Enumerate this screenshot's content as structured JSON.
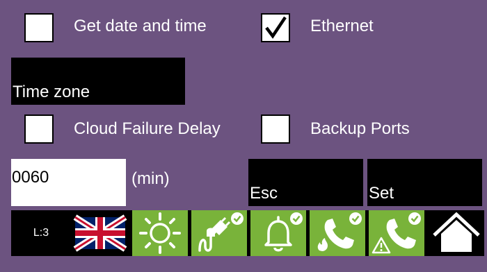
{
  "options": {
    "get_date_time": {
      "label": "Get date and time",
      "checked": false
    },
    "ethernet": {
      "label": "Ethernet",
      "checked": true
    },
    "cloud_failure_delay": {
      "label": "Cloud Failure Delay",
      "checked": false
    },
    "backup_ports": {
      "label": "Backup Ports",
      "checked": false
    }
  },
  "time_zone": {
    "label": "Time zone"
  },
  "delay": {
    "value": "0060",
    "unit": "(min)"
  },
  "buttons": {
    "esc": "Esc",
    "set": "Set"
  },
  "status_bar": {
    "level": "L:3",
    "icons": [
      "uk-flag-icon",
      "sun-icon",
      "power-plug-ok-icon",
      "bell-ok-icon",
      "fire-call-ok-icon",
      "alert-call-ok-icon",
      "home-icon"
    ]
  },
  "colors": {
    "background": "#6c5380",
    "status_ok_green": "#79b33a",
    "block": "#000000"
  }
}
